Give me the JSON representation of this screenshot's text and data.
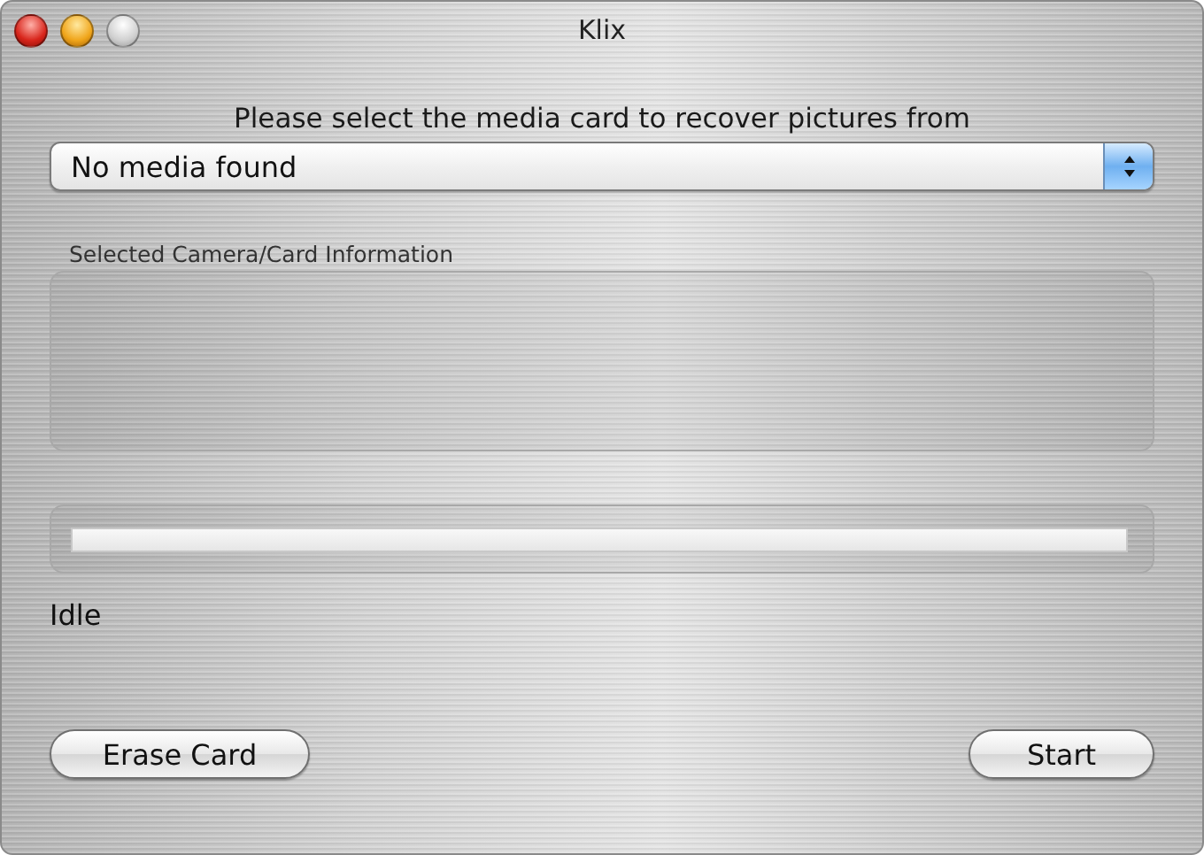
{
  "window": {
    "title": "Klix",
    "buttons": [
      {
        "kind": "close"
      },
      {
        "kind": "minimize"
      },
      {
        "kind": "zoom"
      }
    ]
  },
  "prompt": "Please select the media card to recover pictures from",
  "media_select": {
    "value": "No media found"
  },
  "info_group": {
    "label": "Selected Camera/Card Information"
  },
  "progress": {
    "level": 0
  },
  "status": "Idle",
  "actions": [
    {
      "label": "Erase Card"
    },
    {
      "label": "Start"
    }
  ]
}
